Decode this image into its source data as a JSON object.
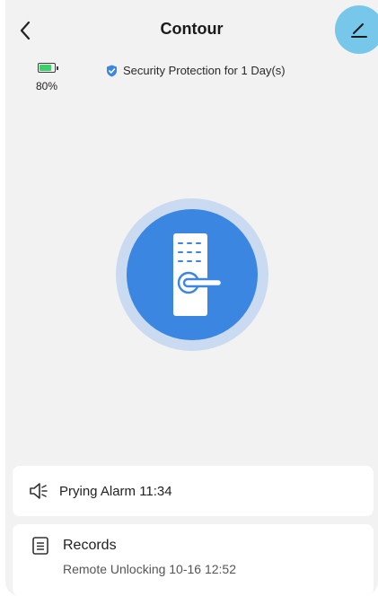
{
  "header": {
    "title": "Contour",
    "back_icon": "chevron-left-icon",
    "edit_icon": "pencil-icon",
    "edit_button_color": "#77c7ea"
  },
  "status": {
    "battery_level": "80%",
    "battery_icon": "battery-icon",
    "battery_color": "#3fcf6a",
    "security_text": "Security Protection for 1 Day(s)",
    "security_icon": "shield-check-icon",
    "accent": "#3a86e0"
  },
  "lock": {
    "icon": "door-lock-icon",
    "circle_color": "#3a86e0",
    "halo_color": "#c9daf1"
  },
  "alarm": {
    "icon": "speaker-alarm-icon",
    "text": "Prying Alarm 11:34"
  },
  "records": {
    "icon": "list-icon",
    "label": "Records",
    "latest": "Remote Unlocking 10-16 12:52"
  }
}
